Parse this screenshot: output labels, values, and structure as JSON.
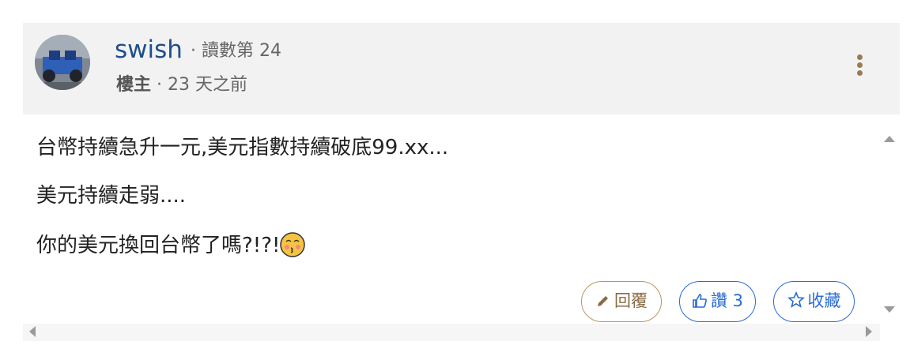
{
  "post": {
    "author": "swish",
    "floor": "· 讀數第 24",
    "role": "樓主",
    "separator": " · ",
    "time": "23 天之前",
    "lines": [
      "台幣持續急升一元,美元指數持續破底99.xx...",
      "美元持續走弱....",
      "你的美元換回台幣了嗎?!?!"
    ],
    "emoji": "kissing-face-emoji"
  },
  "actions": {
    "reply_label": "回覆",
    "like_label": "讚 3",
    "fav_label": "收藏"
  },
  "colors": {
    "header_bg": "#f2f2f2",
    "username": "#1e4e8c",
    "reply_accent": "#b79566",
    "like_accent": "#2a6bd1"
  },
  "icons": [
    "more-vertical-icon",
    "pencil-icon",
    "thumbs-up-icon",
    "star-outline-icon"
  ]
}
